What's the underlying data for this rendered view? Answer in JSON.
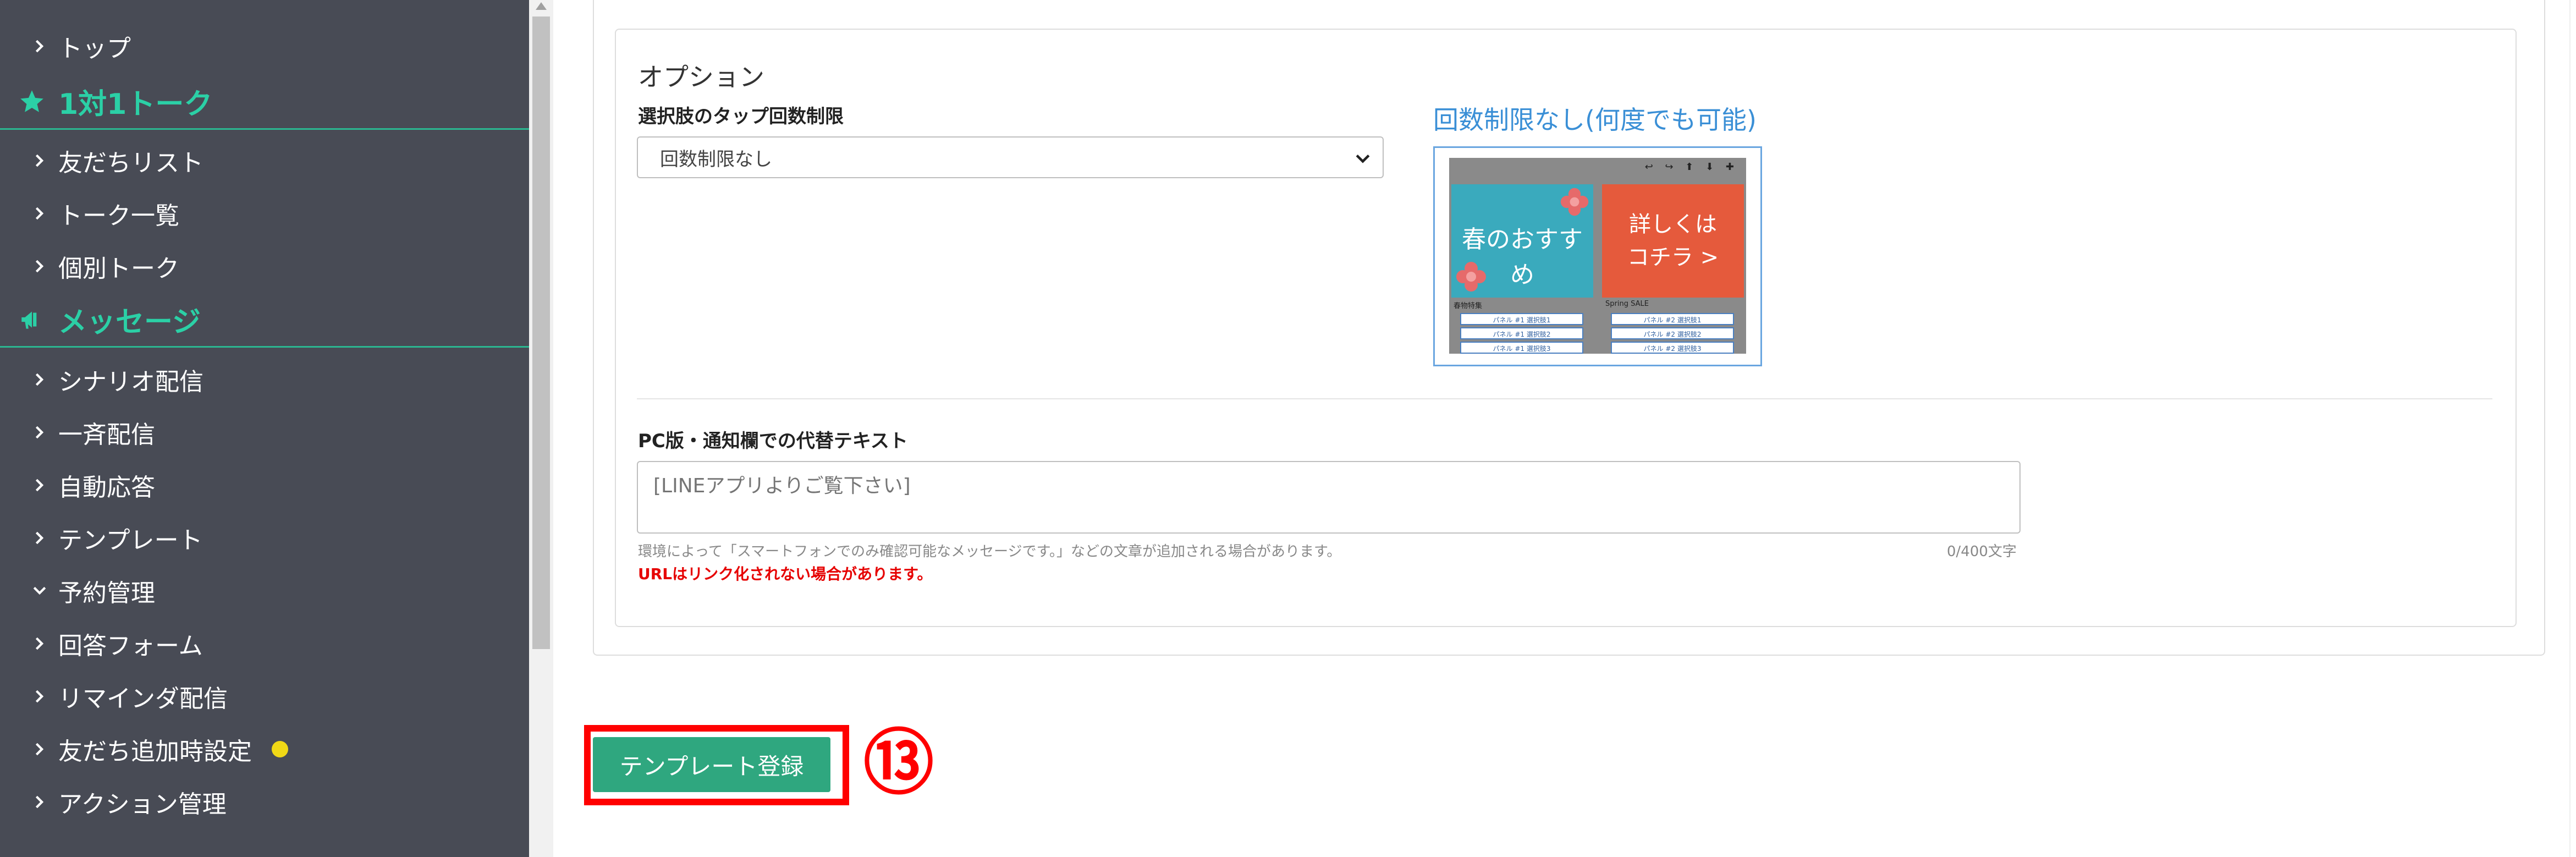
{
  "sidebar": {
    "top": "トップ",
    "section_talk": "1対1トーク",
    "talk_items": [
      "友だちリスト",
      "トーク一覧",
      "個別トーク"
    ],
    "section_message": "メッセージ",
    "message_items": [
      "シナリオ配信",
      "一斉配信",
      "自動応答",
      "テンプレート"
    ],
    "reservation": "予約管理",
    "other_items": [
      "回答フォーム",
      "リマインダ配信",
      "友だち追加時設定",
      "アクション管理"
    ],
    "badge_color": "#f0d816",
    "accent_color": "#2bd0a6"
  },
  "options": {
    "heading": "オプション",
    "tap_limit_label": "選択肢のタップ回数制限",
    "tap_limit_value": "回数制限なし",
    "preview_title": "回数制限なし(何度でも可能)",
    "preview": {
      "panel_left_text": "春のおすすめ",
      "panel_right_text_1": "詳しくは",
      "panel_right_text_2": "コチラ >",
      "caption_left": "春物特集",
      "caption_right": "Spring SALE",
      "buttons_left": [
        "パネル #1 選択肢1",
        "パネル #1 選択肢2",
        "パネル #1 選択肢3"
      ],
      "buttons_right": [
        "パネル #2 選択肢1",
        "パネル #2 選択肢2",
        "パネル #2 選択肢3"
      ]
    },
    "alt_text_label": "PC版・通知欄での代替テキスト",
    "alt_text_placeholder": "[LINEアプリよりご覧下さい]",
    "alt_text_help": "環境によって「スマートフォンでのみ確認可能なメッセージです。」などの文章が追加される場合があります。",
    "alt_text_counter": "0/400文字",
    "url_warning": "URLはリンク化されない場合があります。"
  },
  "actions": {
    "register_label": "テンプレート登録",
    "step_marker": "⑬"
  },
  "colors": {
    "sidebar_bg": "#484b55",
    "register_button": "#2fa77f",
    "highlight": "#ff0000",
    "preview_title": "#3a8fd6"
  }
}
